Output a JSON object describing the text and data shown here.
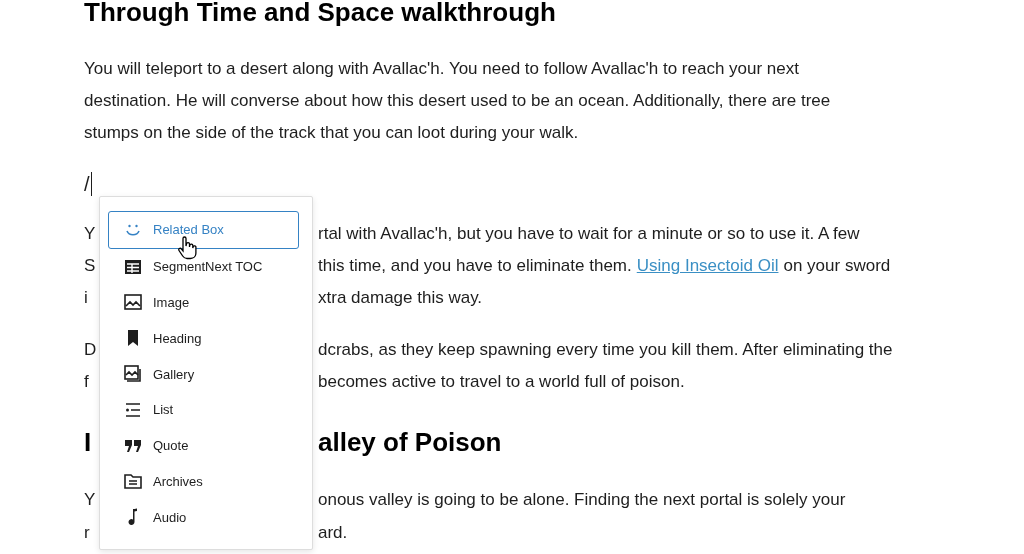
{
  "heading": "Through Time and Space walkthrough",
  "blocks": [
    {
      "kind": "paragraph",
      "text": "You will teleport to a desert along with Avallac'h. You need to follow Avallac'h to reach your next destination. He will converse about how this desert used to be an ocean. Additionally, there are tree stumps on the side of the track that you can loot during your walk."
    },
    {
      "kind": "slash",
      "text": "/"
    },
    {
      "kind": "covered",
      "lines": [
        {
          "left": "Y",
          "right": [
            {
              "kind": "text",
              "text": "rtal with Avallac'h, but you have to wait for a minute or so to use it. A few"
            }
          ]
        },
        {
          "left": "S",
          "right": [
            {
              "kind": "text",
              "text": "this time, and you have to eliminate them."
            },
            {
              "kind": "link",
              "text": "Using Insectoid Oil"
            },
            {
              "kind": "text",
              "text": "on your sword"
            }
          ]
        },
        {
          "left": "i",
          "right": [
            {
              "kind": "text",
              "text": "xtra damage this way."
            }
          ]
        }
      ]
    },
    {
      "kind": "covered",
      "lines": [
        {
          "left": "D",
          "right": [
            {
              "kind": "text",
              "text": "dcrabs, as they keep spawning every time you kill them. After eliminating the"
            }
          ]
        },
        {
          "left": "f",
          "right": [
            {
              "kind": "text",
              "text": "becomes active to travel to a world full of poison."
            }
          ]
        }
      ]
    },
    {
      "kind": "covered-heading",
      "lines": [
        {
          "left": "I",
          "right": [
            {
              "kind": "text",
              "text": "alley of Poison"
            }
          ]
        }
      ]
    },
    {
      "kind": "covered",
      "lines": [
        {
          "left": "Y",
          "right": [
            {
              "kind": "text",
              "text": "onous valley is going to be alone. Finding the next portal is solely your"
            }
          ]
        },
        {
          "left": "r",
          "right": [
            {
              "kind": "text",
              "text": "ard."
            }
          ]
        }
      ]
    }
  ],
  "menu": [
    {
      "label": "Related Box",
      "selected": true
    },
    {
      "label": "SegmentNext TOC",
      "selected": false
    },
    {
      "label": "Image",
      "selected": false
    },
    {
      "label": "Heading",
      "selected": false
    },
    {
      "label": "Gallery",
      "selected": false
    },
    {
      "label": "List",
      "selected": false
    },
    {
      "label": "Quote",
      "selected": false
    },
    {
      "label": "Archives",
      "selected": false
    },
    {
      "label": "Audio",
      "selected": false
    }
  ]
}
